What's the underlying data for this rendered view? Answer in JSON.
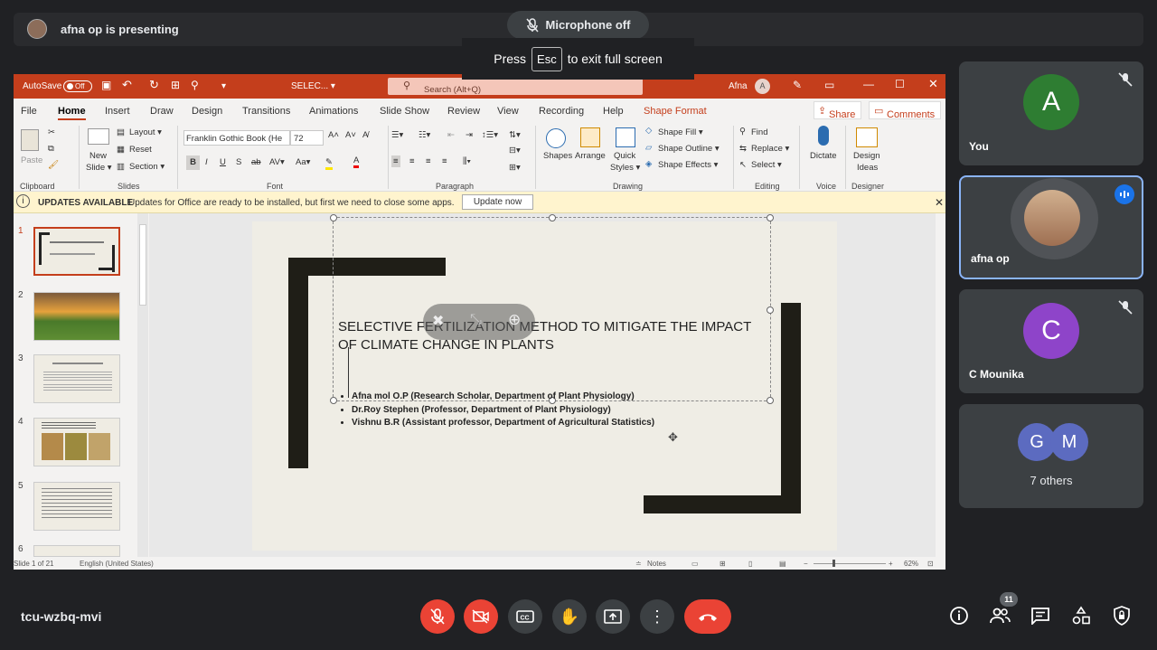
{
  "meet": {
    "presenting_text": "afna op is presenting",
    "mic_off_label": "Microphone off",
    "esc_press": "Press",
    "esc_key": "Esc",
    "esc_suffix": "to exit full screen",
    "meeting_code": "tcu-wzbq-mvi",
    "participants_count": "11"
  },
  "ppt": {
    "autosave": "AutoSave",
    "autosave_state": "Off",
    "doc_name": "SELEC... ▾",
    "search_placeholder": "Search (Alt+Q)",
    "user_name": "Afna",
    "user_initial": "A",
    "tabs": [
      "File",
      "Home",
      "Insert",
      "Draw",
      "Design",
      "Transitions",
      "Animations",
      "Slide Show",
      "Review",
      "View",
      "Recording",
      "Help",
      "Shape Format"
    ],
    "share": "Share",
    "comments": "Comments",
    "ribbon": {
      "paste": "Paste",
      "new_slide": "New",
      "new_slide2": "Slide ▾",
      "layout": "Layout ▾",
      "reset": "Reset",
      "section": "Section ▾",
      "font_name": "Franklin Gothic Book (He",
      "font_size": "72",
      "shapes": "Shapes",
      "arrange": "Arrange",
      "quick_styles": "Quick",
      "quick_styles2": "Styles ▾",
      "shape_fill": "Shape Fill ▾",
      "shape_outline": "Shape Outline ▾",
      "shape_effects": "Shape Effects ▾",
      "find": "Find",
      "replace": "Replace ▾",
      "select": "Select ▾",
      "dictate": "Dictate",
      "design_ideas": "Design",
      "design_ideas2": "Ideas",
      "groups": [
        "Clipboard",
        "Slides",
        "Font",
        "Paragraph",
        "Drawing",
        "Editing",
        "Voice",
        "Designer"
      ]
    },
    "updates_title": "UPDATES AVAILABLE",
    "updates_text": "Updates for Office are ready to be installed, but first we need to close some apps.",
    "update_now": "Update now",
    "slide_numbers": [
      "1",
      "2",
      "3",
      "4",
      "5",
      "6"
    ],
    "slide": {
      "title": "SELECTIVE FERTILIZATION METHOD TO MITIGATE THE IMPACT OF CLIMATE CHANGE IN PLANTS",
      "bullets": [
        "Afna mol O.P (Research Scholar, Department of Plant Physiology)",
        "Dr.Roy Stephen (Professor, Department of Plant Physiology)",
        "Vishnu B.R (Assistant professor, Department of Agricultural Statistics)"
      ]
    },
    "status": {
      "slide_of": "Slide 1 of 21",
      "language": "English (United States)",
      "notes": "Notes",
      "zoom": "62%"
    }
  },
  "participants": [
    {
      "name": "You",
      "initial": "A",
      "color": "#2e7d32"
    },
    {
      "name": "afna op"
    },
    {
      "name": "C Mounika",
      "initial": "C",
      "color": "#8e44c9"
    },
    {
      "name": "7 others",
      "initials": [
        "G",
        "M"
      ],
      "color": "#5c6bc0"
    }
  ]
}
